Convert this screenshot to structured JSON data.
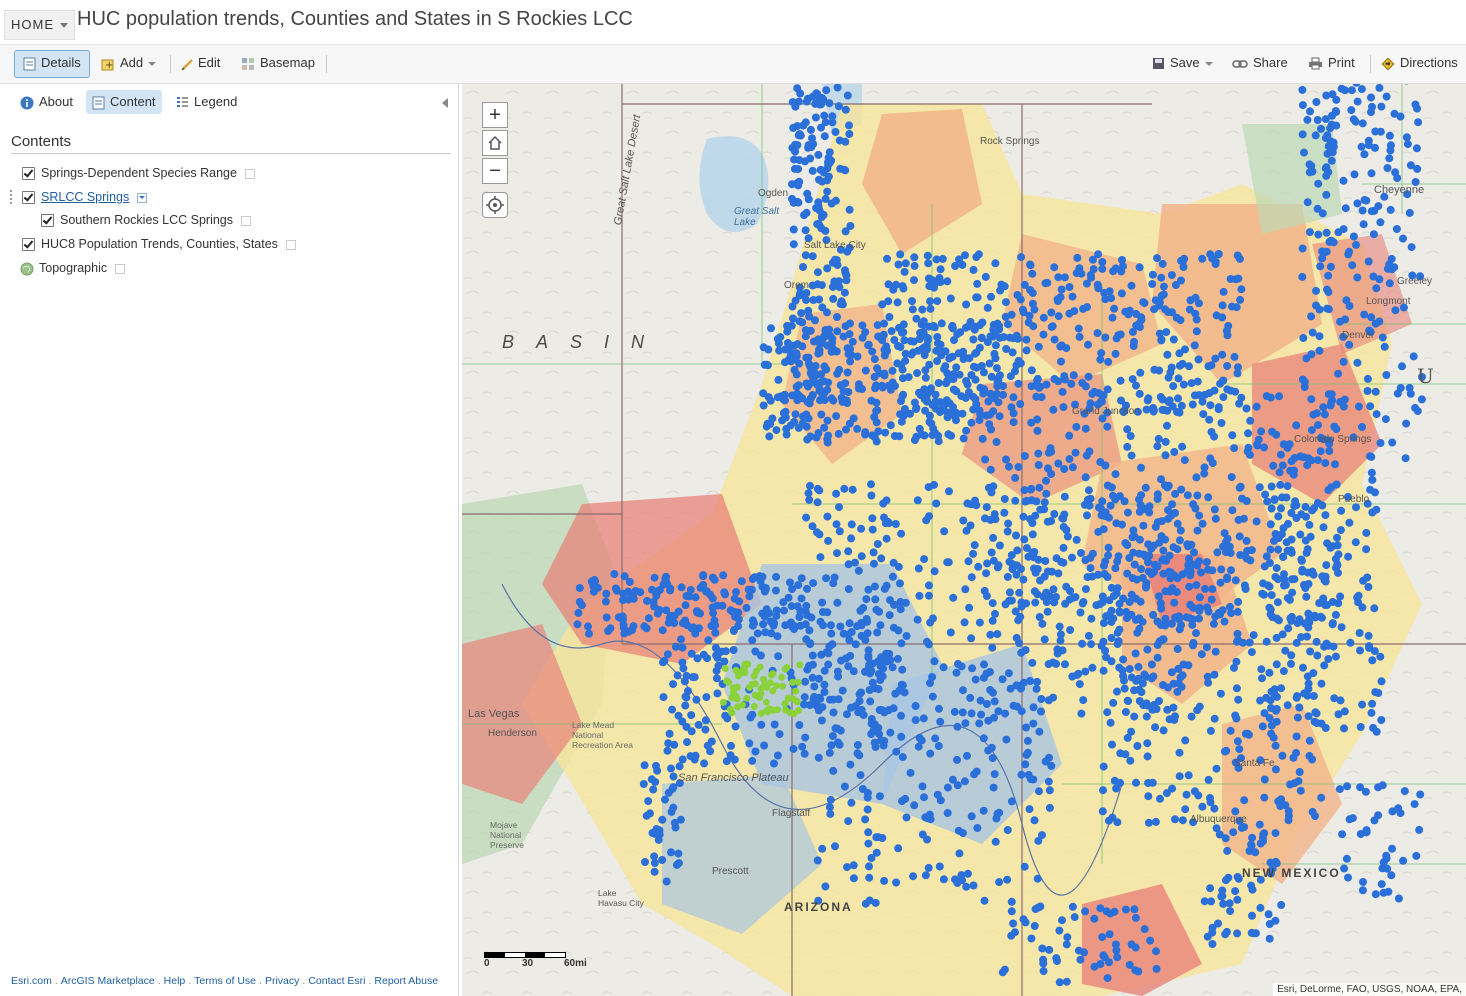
{
  "header": {
    "home_label": "HOME",
    "title": "HUC population trends, Counties and States in S Rockies LCC"
  },
  "toolbar": {
    "details": "Details",
    "add": "Add",
    "edit": "Edit",
    "basemap": "Basemap",
    "save": "Save",
    "share": "Share",
    "print": "Print",
    "directions": "Directions"
  },
  "panel": {
    "tabs": {
      "about": "About",
      "content": "Content",
      "legend": "Legend"
    },
    "active_tab": "Content",
    "heading": "Contents",
    "layers": [
      {
        "label": "Springs-Dependent Species Range",
        "checked": true
      },
      {
        "label": "SRLCC Springs",
        "checked": true
      },
      {
        "label": "Southern Rockies LCC Springs",
        "checked": true
      },
      {
        "label": "HUC8 Population Trends, Counties, States",
        "checked": true
      },
      {
        "label": "Topographic"
      }
    ],
    "footer_links": [
      "Esri.com",
      "ArcGIS Marketplace",
      "Help",
      "Terms of Use",
      "Privacy",
      "Contact Esri",
      "Report Abuse"
    ]
  },
  "map": {
    "zoom_in": "+",
    "zoom_out": "−",
    "labels": {
      "rock_springs": "Rock Springs",
      "cheyenne": "Cheyenne",
      "ogden": "Ogden",
      "great_salt_lake": "Great Salt Lake",
      "great_salt_lake_desert": "Great Salt Lake Desert",
      "salt_lake_city": "Salt Lake City",
      "orem": "Orem",
      "greeley": "Greeley",
      "longmont": "Longmont",
      "denver": "Denver",
      "basin": "BASIN",
      "u": "U",
      "grand_junction": "Grand Junction",
      "colorado_springs": "Colorado Springs",
      "pueblo": "Pueblo",
      "las_vegas": "Las Vegas",
      "henderson": "Henderson",
      "san_francisco_plateau": "San Francisco Plateau",
      "flagstaff": "Flagstaff",
      "prescott": "Prescott",
      "arizona": "ARIZONA",
      "santa_fe": "Santa Fe",
      "albuquerque": "Albuquerque",
      "new_mexico": "NEW MEXICO",
      "lake_havasu_city": "Lake Havasu City",
      "mojave_national_preserve": "Mojave National Preserve",
      "lake_mead_national_recreation_area": "Lake Mead National Recreation Area"
    },
    "scale": {
      "zero": "0",
      "mid": "30",
      "max": "60mi"
    },
    "attribution": "Esri, DeLorme, FAO, USGS, NOAA, EPA,"
  },
  "colors": {
    "accent": "#d3e5f5",
    "spring_points": "#2b6fd8",
    "species_points": "#8bd13a",
    "huc_decline": "#e8837a",
    "huc_growth_high": "#f2b48a",
    "huc_growth_low": "#f7e59a",
    "huc_stable": "#a9c6e3"
  }
}
